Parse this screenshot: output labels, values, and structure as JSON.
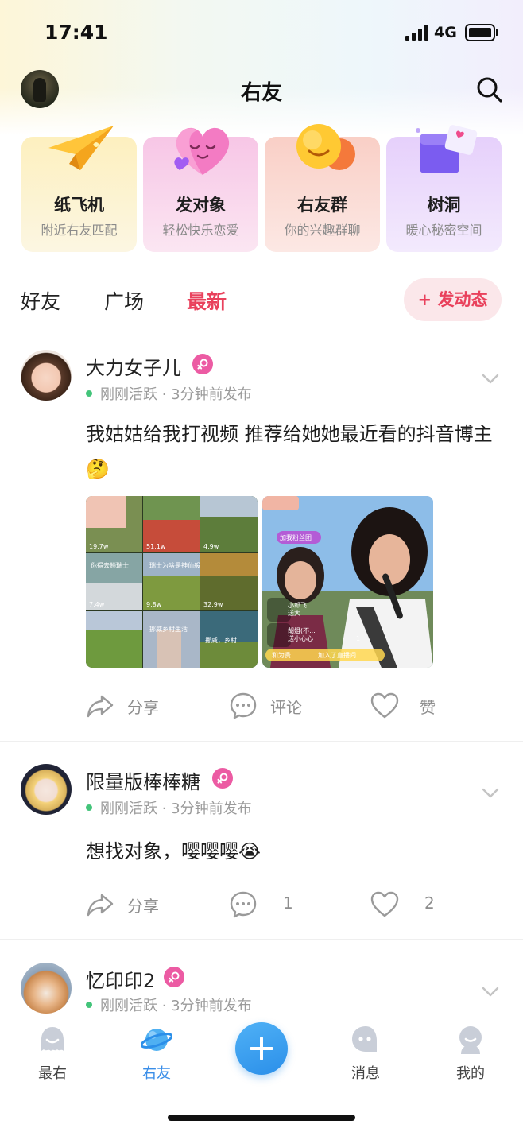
{
  "status_bar": {
    "time": "17:41",
    "network": "4G"
  },
  "header": {
    "title": "右友"
  },
  "feature_cards": [
    {
      "title": "纸飞机",
      "subtitle": "附近右友匹配",
      "icon": "paper-plane-icon",
      "bg": "#fbf0c4"
    },
    {
      "title": "发对象",
      "subtitle": "轻松快乐恋爱",
      "icon": "heart-face-icon",
      "bg": "#f8d6ea"
    },
    {
      "title": "右友群",
      "subtitle": "你的兴趣群聊",
      "icon": "smile-chat-icon",
      "bg": "#fbded6"
    },
    {
      "title": "树洞",
      "subtitle": "暖心秘密空间",
      "icon": "letter-box-icon",
      "bg": "#eadcf8"
    }
  ],
  "tabs": [
    {
      "label": "好友",
      "active": false
    },
    {
      "label": "广场",
      "active": false
    },
    {
      "label": "最新",
      "active": true
    }
  ],
  "post_button": "+ 发动态",
  "posts": [
    {
      "name": "大力女子儿",
      "status": "刚刚活跃",
      "time": "3分钟前发布",
      "text": "我姑姑给我打视频 推荐给她她最近看的抖音博主 🤔",
      "images": [
        {
          "kind": "grid",
          "captions": [
            "19.7w",
            "51.1w",
            "4.9w",
            "你得去趟瑞士",
            "瑞士为啥是神仙般",
            "7.4w",
            "9.8w",
            "32.9w",
            "挪威乡村生活",
            "挪威，乡村"
          ]
        },
        {
          "kind": "live",
          "captions": [
            "加我粉丝团",
            "小郎飞",
            "送大",
            "胡姐(不...",
            "送小心心",
            "1",
            "和为贵",
            "加入了直播间"
          ]
        }
      ],
      "actions": {
        "share": "分享",
        "comment": "评论",
        "like": "赞"
      }
    },
    {
      "name": "限量版棒棒糖",
      "status": "刚刚活跃",
      "time": "3分钟前发布",
      "text": "想找对象，嘤嘤嘤😭",
      "actions": {
        "share": "分享",
        "comment": "1",
        "like": "2"
      }
    },
    {
      "name": "忆印印2",
      "status": "刚刚活跃",
      "time": "3分钟前发布"
    }
  ],
  "bottom_nav": [
    {
      "label": "最右",
      "icon": "ghost-icon",
      "active": false
    },
    {
      "label": "右友",
      "icon": "planet-icon",
      "active": true
    },
    {
      "label": "",
      "icon": "plus-icon",
      "active": false
    },
    {
      "label": "消息",
      "icon": "message-icon",
      "active": false
    },
    {
      "label": "我的",
      "icon": "profile-icon",
      "active": false
    }
  ],
  "colors": {
    "accent": "#e9415c",
    "nav_active": "#3a8ee8",
    "online": "#43c47a",
    "female_badge": "#ec5ba3"
  }
}
